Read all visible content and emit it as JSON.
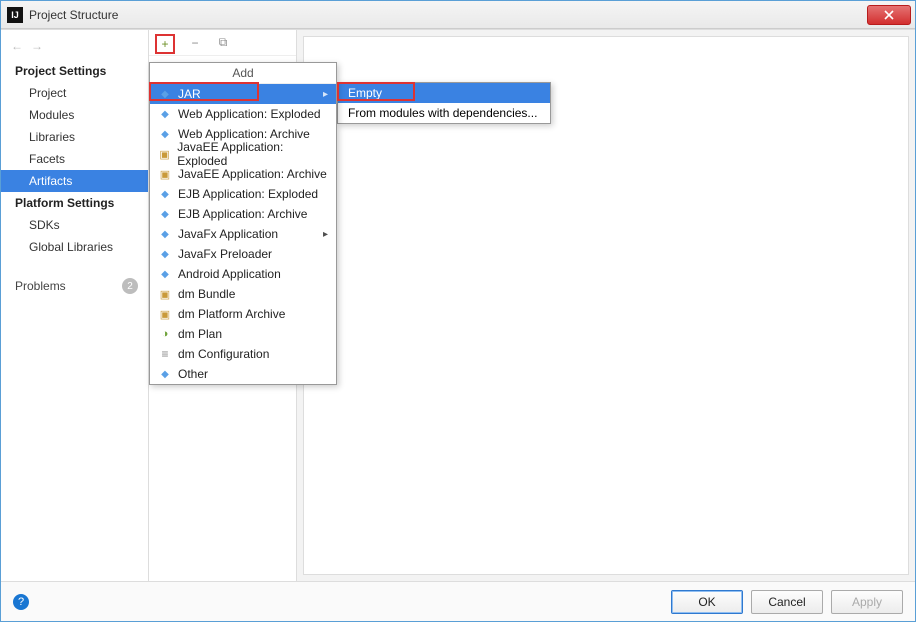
{
  "window": {
    "title": "Project Structure"
  },
  "sidebar": {
    "section1": "Project Settings",
    "items1": [
      "Project",
      "Modules",
      "Libraries",
      "Facets",
      "Artifacts"
    ],
    "selected1": "Artifacts",
    "section2": "Platform Settings",
    "items2": [
      "SDKs",
      "Global Libraries"
    ],
    "problems_label": "Problems",
    "problems_count": "2"
  },
  "toolbar": {
    "add_tooltip": "Add",
    "remove_tooltip": "Remove",
    "copy_tooltip": "Copy"
  },
  "add_menu": {
    "header": "Add",
    "items": [
      {
        "label": "JAR",
        "icon": "blue-dots",
        "submenu": true,
        "selected": true
      },
      {
        "label": "Web Application: Exploded",
        "icon": "blue-dots"
      },
      {
        "label": "Web Application: Archive",
        "icon": "blue-dots"
      },
      {
        "label": "JavaEE Application: Exploded",
        "icon": "box-ico"
      },
      {
        "label": "JavaEE Application: Archive",
        "icon": "box-ico"
      },
      {
        "label": "EJB Application: Exploded",
        "icon": "blue-dots"
      },
      {
        "label": "EJB Application: Archive",
        "icon": "blue-dots"
      },
      {
        "label": "JavaFx Application",
        "icon": "blue-dots",
        "submenu": true
      },
      {
        "label": "JavaFx Preloader",
        "icon": "blue-dots"
      },
      {
        "label": "Android Application",
        "icon": "blue-dots"
      },
      {
        "label": "dm Bundle",
        "icon": "box-ico"
      },
      {
        "label": "dm Platform Archive",
        "icon": "box-ico"
      },
      {
        "label": "dm Plan",
        "icon": "green-ico"
      },
      {
        "label": "dm Configuration",
        "icon": "cfg-ico"
      },
      {
        "label": "Other",
        "icon": "blue-dots"
      }
    ]
  },
  "jar_submenu": {
    "items": [
      {
        "label": "Empty",
        "selected": true
      },
      {
        "label": "From modules with dependencies..."
      }
    ]
  },
  "footer": {
    "ok": "OK",
    "cancel": "Cancel",
    "apply": "Apply"
  },
  "highlights": [
    "plus-button",
    "jar-menu-item",
    "empty-submenu-item"
  ]
}
